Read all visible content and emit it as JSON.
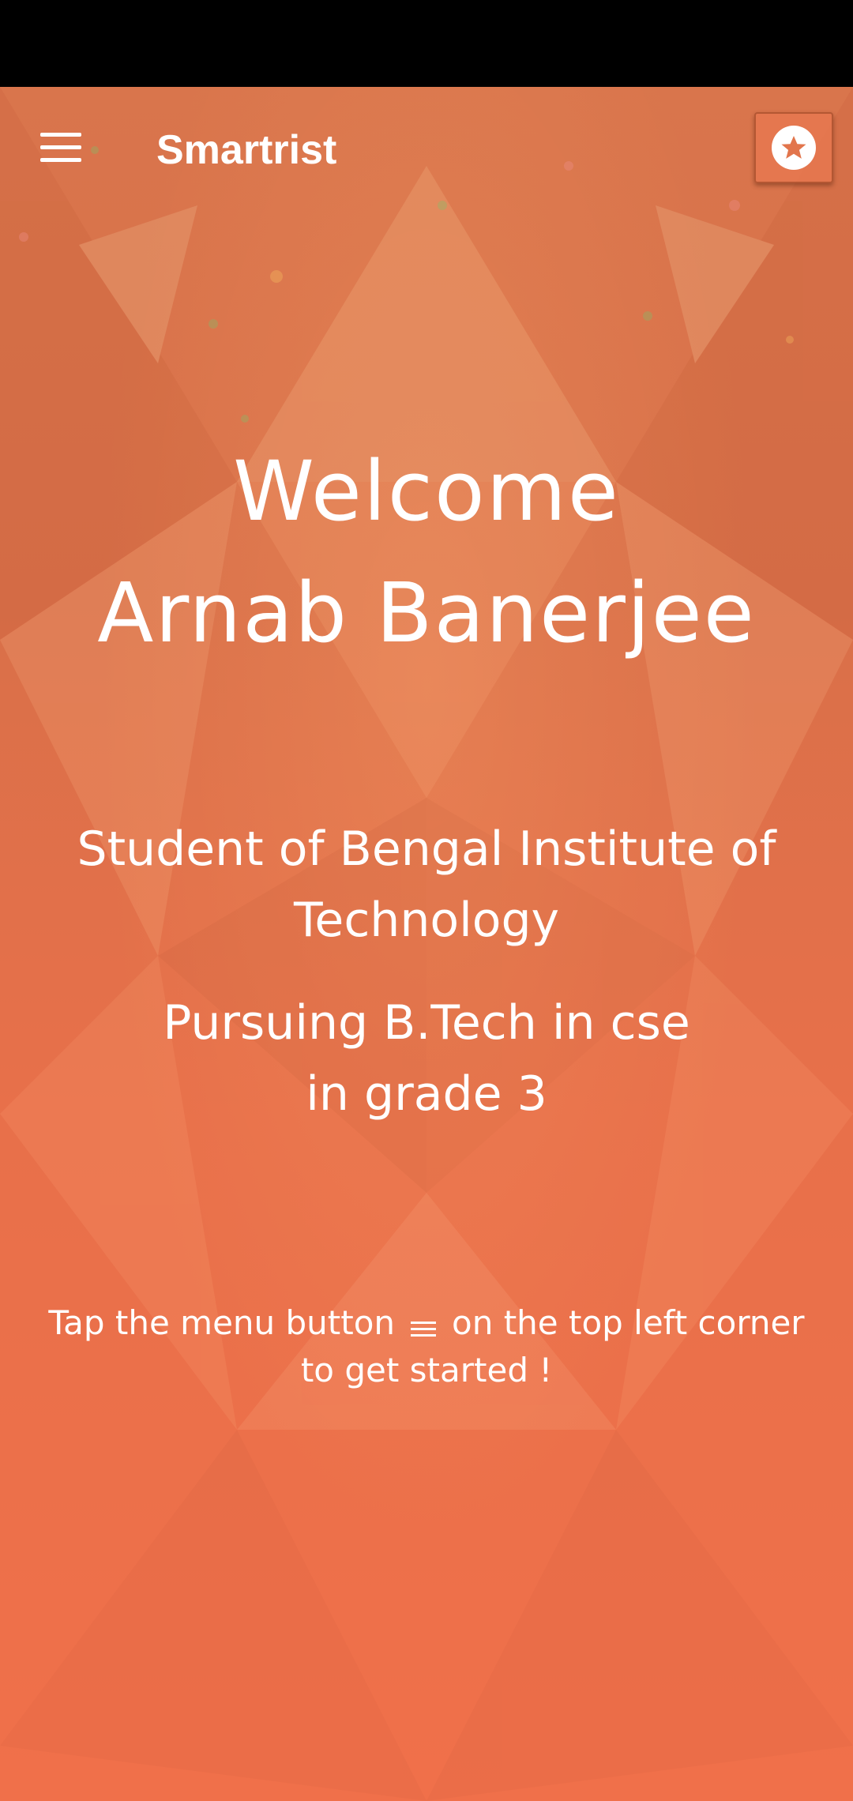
{
  "app_bar": {
    "title": "Smartrist",
    "menu_icon": "hamburger-menu-icon",
    "action_icon": "star-circle-icon"
  },
  "welcome": {
    "line1": "Welcome",
    "line2": "Arnab Banerjee"
  },
  "info": {
    "institute_line1": "Student of Bengal Institute of",
    "institute_line2": "Technology",
    "course_line": "Pursuing B.Tech in cse",
    "grade_line": "in grade 3"
  },
  "hint": {
    "before_icon": "Tap the menu button",
    "icon": "hamburger-menu-icon",
    "after_icon": "on the top left corner",
    "line2": "to get started !"
  },
  "colors": {
    "status_bar": "#000000",
    "background_top": "#d9754c",
    "background_bottom": "#f0704a",
    "text": "#ffffff"
  }
}
